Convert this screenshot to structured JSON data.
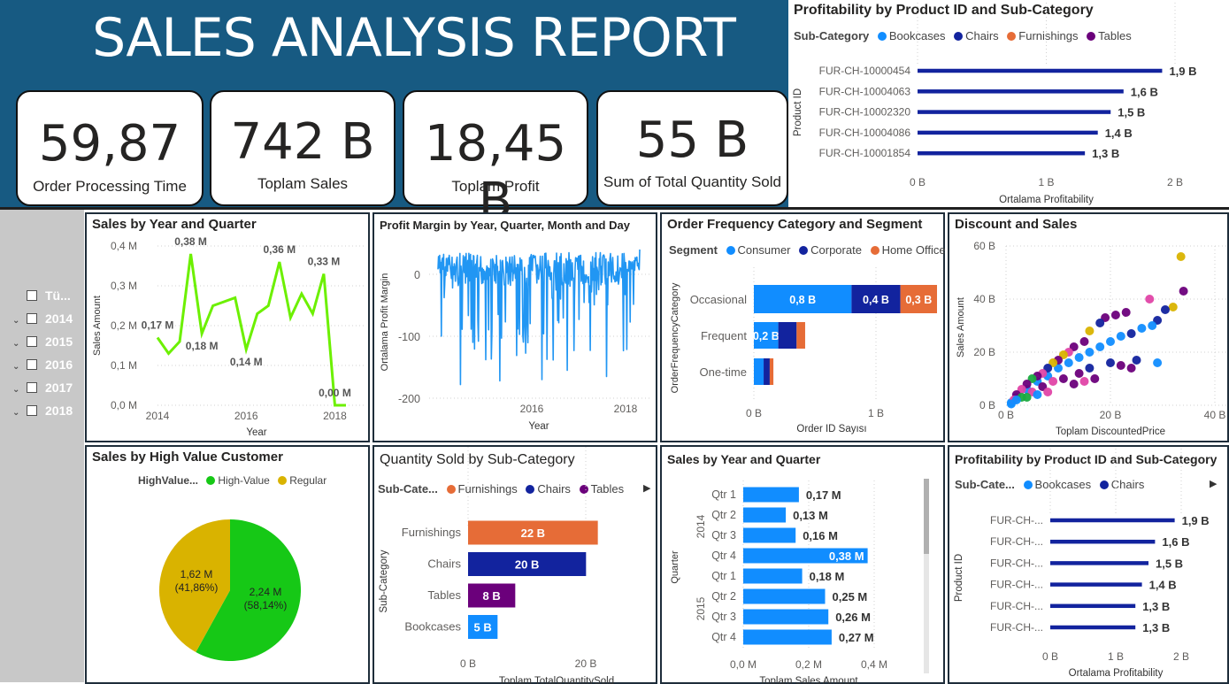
{
  "header": {
    "title": "SALES ANALYSIS REPORT"
  },
  "kpis": [
    {
      "value": "59,87",
      "label": "Order Processing Time"
    },
    {
      "value": "742 B",
      "label": "Toplam Sales"
    },
    {
      "value": "18,45 B",
      "label": "Toplam Profit"
    },
    {
      "value": "55 B",
      "label": "Sum of Total Quantity Sold"
    }
  ],
  "slicer": {
    "items": [
      {
        "label": "Tü...",
        "chevron": false
      },
      {
        "label": "2014",
        "chevron": true
      },
      {
        "label": "2015",
        "chevron": true
      },
      {
        "label": "2016",
        "chevron": true
      },
      {
        "label": "2017",
        "chevron": true
      },
      {
        "label": "2018",
        "chevron": true
      }
    ]
  },
  "colors": {
    "header": "#175a82",
    "light_blue": "#118dff",
    "navy": "#12239e",
    "orange": "#e66c37",
    "purple": "#6b007b",
    "lime": "#6cf000",
    "green": "#16c816",
    "gold": "#d9b300",
    "line_blue": "#2196f3"
  },
  "chart_data": [
    {
      "id": "profit_top",
      "type": "bar",
      "title": "Profitability by Product ID and Sub-Category",
      "legend_title": "Sub-Category",
      "legend": [
        "Bookcases",
        "Chairs",
        "Furnishings",
        "Tables"
      ],
      "categories": [
        "FUR-CH-10000454",
        "FUR-CH-10004063",
        "FUR-CH-10002320",
        "FUR-CH-10004086",
        "FUR-CH-10001854"
      ],
      "values": [
        1.9,
        1.6,
        1.5,
        1.4,
        1.3
      ],
      "data_labels": [
        "1,9 B",
        "1,6 B",
        "1,5 B",
        "1,4 B",
        "1,3 B"
      ],
      "xlabel": "Ortalama Profitability",
      "ylabel": "Product ID",
      "xticks": [
        "0 B",
        "1 B",
        "2 B"
      ],
      "xlim": [
        0,
        2
      ]
    },
    {
      "id": "sales_year_quarter_line",
      "type": "line",
      "title": "Sales by Year and Quarter",
      "xlabel": "Year",
      "ylabel": "Sales Amount",
      "xticks": [
        "2014",
        "2016",
        "2018"
      ],
      "yticks": [
        "0,0 M",
        "0,1 M",
        "0,2 M",
        "0,3 M",
        "0,4 M"
      ],
      "ylim": [
        0,
        0.4
      ],
      "x": [
        2014.0,
        2014.25,
        2014.5,
        2014.75,
        2015.0,
        2015.25,
        2015.5,
        2015.75,
        2016.0,
        2016.25,
        2016.5,
        2016.75,
        2017.0,
        2017.25,
        2017.5,
        2017.75,
        2018.0,
        2018.25
      ],
      "values": [
        0.17,
        0.13,
        0.16,
        0.38,
        0.18,
        0.25,
        0.26,
        0.27,
        0.14,
        0.23,
        0.25,
        0.36,
        0.22,
        0.28,
        0.23,
        0.33,
        0.0,
        0.0
      ],
      "annotations": [
        {
          "index": 0,
          "label": "0,17 M",
          "pos": "above"
        },
        {
          "index": 3,
          "label": "0,38 M",
          "pos": "above"
        },
        {
          "index": 4,
          "label": "0,18 M",
          "pos": "below"
        },
        {
          "index": 8,
          "label": "0,14 M",
          "pos": "below"
        },
        {
          "index": 11,
          "label": "0,36 M",
          "pos": "above"
        },
        {
          "index": 15,
          "label": "0,33 M",
          "pos": "above"
        },
        {
          "index": 16,
          "label": "0,00 M",
          "pos": "above"
        }
      ]
    },
    {
      "id": "profit_margin",
      "type": "line",
      "title": "Profit Margin by Year, Quarter, Month and Day",
      "xlabel": "Year",
      "ylabel": "Ortalama Profit Margin",
      "xticks": [
        "2016",
        "2018"
      ],
      "yticks": [
        "0",
        "-100",
        "-200"
      ],
      "ylim": [
        -210,
        40
      ],
      "note": "dense daily series between 2014 and 2018; values mostly near 0 with frequent dips toward -150 and deeper"
    },
    {
      "id": "order_frequency",
      "type": "bar",
      "stacked": true,
      "title": "Order Frequency Category and Segment",
      "legend_title": "Segment",
      "legend": [
        "Consumer",
        "Corporate",
        "Home Office"
      ],
      "categories": [
        "Occasional",
        "Frequent",
        "One-time"
      ],
      "series": [
        {
          "name": "Consumer",
          "values": [
            0.8,
            0.2,
            0.08
          ],
          "labels": [
            "0,8 B",
            "0,2 B",
            ""
          ]
        },
        {
          "name": "Corporate",
          "values": [
            0.4,
            0.15,
            0.05
          ],
          "labels": [
            "0,4 B",
            "",
            ""
          ]
        },
        {
          "name": "Home Office",
          "values": [
            0.3,
            0.07,
            0.03
          ],
          "labels": [
            "0,3 B",
            "",
            ""
          ]
        }
      ],
      "xlabel": "Order ID Sayısı",
      "ylabel": "OrderFrequencyCategory",
      "xticks": [
        "0 B",
        "1 B"
      ],
      "xlim": [
        0,
        1.5
      ]
    },
    {
      "id": "discount_sales",
      "type": "scatter",
      "title": "Discount and Sales",
      "xlabel": "Toplam DiscountedPrice",
      "ylabel": "Sales Amount",
      "xticks": [
        "0 B",
        "20 B",
        "40 B"
      ],
      "yticks": [
        "0 B",
        "20 B",
        "40 B",
        "60 B"
      ],
      "xlim": [
        0,
        40
      ],
      "ylim": [
        0,
        60
      ],
      "points": [
        [
          33.5,
          56,
          "gold"
        ],
        [
          34,
          43,
          "purple"
        ],
        [
          27.5,
          40,
          "pink"
        ],
        [
          32,
          37,
          "gold"
        ],
        [
          30.5,
          36,
          "navy"
        ],
        [
          29,
          32,
          "navy"
        ],
        [
          28,
          30,
          "light_blue"
        ],
        [
          26,
          29,
          "light_blue"
        ],
        [
          24,
          27,
          "navy"
        ],
        [
          22,
          26,
          "light_blue"
        ],
        [
          20,
          24,
          "light_blue"
        ],
        [
          18,
          22,
          "light_blue"
        ],
        [
          16,
          20,
          "light_blue"
        ],
        [
          14,
          18,
          "light_blue"
        ],
        [
          12,
          16,
          "light_blue"
        ],
        [
          10,
          14,
          "light_blue"
        ],
        [
          8,
          11,
          "light_blue"
        ],
        [
          6,
          9,
          "light_blue"
        ],
        [
          4,
          6,
          "light_blue"
        ],
        [
          2,
          3,
          "light_blue"
        ],
        [
          1,
          1,
          "light_blue"
        ],
        [
          19,
          33,
          "purple"
        ],
        [
          21,
          34,
          "purple"
        ],
        [
          23,
          35,
          "purple"
        ],
        [
          18,
          31,
          "navy"
        ],
        [
          16,
          28,
          "gold"
        ],
        [
          15,
          24,
          "purple"
        ],
        [
          13,
          22,
          "purple"
        ],
        [
          12,
          20,
          "pink"
        ],
        [
          11,
          19,
          "gold"
        ],
        [
          10,
          17,
          "purple"
        ],
        [
          9,
          16,
          "gold"
        ],
        [
          8,
          14,
          "navy"
        ],
        [
          7,
          12,
          "pink"
        ],
        [
          6,
          11,
          "purple"
        ],
        [
          5,
          10,
          "green"
        ],
        [
          4,
          8,
          "purple"
        ],
        [
          3,
          6,
          "pink"
        ],
        [
          2,
          4,
          "purple"
        ],
        [
          1.5,
          2,
          "pink"
        ],
        [
          3,
          3,
          "green"
        ],
        [
          5,
          5,
          "pink"
        ],
        [
          7,
          7,
          "purple"
        ],
        [
          9,
          9,
          "pink"
        ],
        [
          11,
          10,
          "purple"
        ],
        [
          14,
          12,
          "purple"
        ],
        [
          16,
          14,
          "navy"
        ],
        [
          20,
          16,
          "navy"
        ],
        [
          25,
          17,
          "navy"
        ],
        [
          29,
          16,
          "light_blue"
        ],
        [
          22,
          15,
          "purple"
        ],
        [
          24,
          14,
          "purple"
        ],
        [
          13,
          8,
          "purple"
        ],
        [
          15,
          9,
          "pink"
        ],
        [
          17,
          10,
          "purple"
        ],
        [
          6,
          4,
          "light_blue"
        ],
        [
          8,
          5,
          "pink"
        ],
        [
          4,
          3,
          "green"
        ],
        [
          2,
          2,
          "light_blue"
        ],
        [
          1,
          0.5,
          "light_blue"
        ]
      ]
    },
    {
      "id": "high_value_pie",
      "type": "pie",
      "title": "Sales by High Value Customer",
      "legend_title": "HighValue...",
      "legend": [
        "High-Value",
        "Regular"
      ],
      "values": [
        2.24,
        1.62
      ],
      "labels": [
        "2,24 M",
        "1,62 M"
      ],
      "percents": [
        "(58,14%)",
        "(41,86%)"
      ]
    },
    {
      "id": "quantity_subcat",
      "type": "bar",
      "title": "Quantity Sold by Sub-Category",
      "legend_title": "Sub-Cate...",
      "legend": [
        "Furnishings",
        "Chairs",
        "Tables"
      ],
      "categories": [
        "Furnishings",
        "Chairs",
        "Tables",
        "Bookcases"
      ],
      "values": [
        22,
        20,
        8,
        5
      ],
      "data_labels": [
        "22 B",
        "20 B",
        "8 B",
        "5 B"
      ],
      "bar_colors": [
        "orange",
        "navy",
        "purple",
        "light_blue"
      ],
      "xlabel": "Toplam TotalQuantitySold",
      "ylabel": "Sub-Category",
      "xticks": [
        "0 B",
        "20 B"
      ],
      "xlim": [
        0,
        30
      ]
    },
    {
      "id": "sales_year_quarter_bar",
      "type": "bar",
      "title": "Sales by Year and Quarter",
      "groups": [
        "2014",
        "2015"
      ],
      "categories": [
        "Qtr 1",
        "Qtr 2",
        "Qtr 3",
        "Qtr 4",
        "Qtr 1",
        "Qtr 2",
        "Qtr 3",
        "Qtr 4"
      ],
      "values": [
        0.17,
        0.13,
        0.16,
        0.38,
        0.18,
        0.25,
        0.26,
        0.27
      ],
      "data_labels": [
        "0,17 M",
        "0,13 M",
        "0,16 M",
        "0,38 M",
        "0,18 M",
        "0,25 M",
        "0,26 M",
        "0,27 M"
      ],
      "xlabel": "Toplam Sales Amount",
      "ylabel": "Quarter",
      "xticks": [
        "0,0 M",
        "0,2 M",
        "0,4 M"
      ],
      "xlim": [
        0,
        0.4
      ]
    },
    {
      "id": "profit_bottom",
      "type": "bar",
      "title": "Profitability by Product ID and Sub-Category",
      "legend_title": "Sub-Cate...",
      "legend": [
        "Bookcases",
        "Chairs"
      ],
      "categories": [
        "FUR-CH-...",
        "FUR-CH-...",
        "FUR-CH-...",
        "FUR-CH-...",
        "FUR-CH-...",
        "FUR-CH-..."
      ],
      "values": [
        1.9,
        1.6,
        1.5,
        1.4,
        1.3,
        1.3
      ],
      "data_labels": [
        "1,9 B",
        "1,6 B",
        "1,5 B",
        "1,4 B",
        "1,3 B",
        "1,3 B"
      ],
      "xlabel": "Ortalama Profitability",
      "ylabel": "Product ID",
      "xticks": [
        "0 B",
        "1 B",
        "2 B"
      ],
      "xlim": [
        0,
        2
      ]
    }
  ]
}
